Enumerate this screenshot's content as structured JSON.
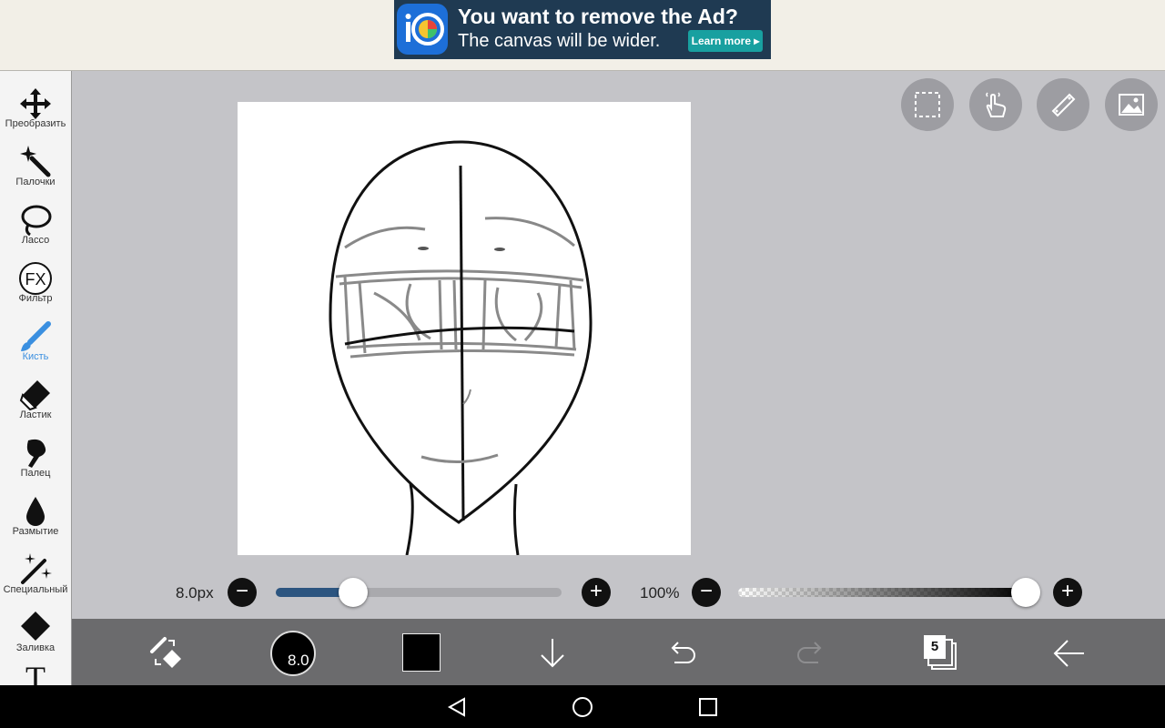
{
  "ad": {
    "title": "You want to remove the Ad?",
    "subtitle": "The canvas will be wider.",
    "cta": "Learn more ▸"
  },
  "tools": [
    {
      "label": "Преобразить",
      "icon": "move-icon"
    },
    {
      "label": "Палочки",
      "icon": "magic-wand-icon"
    },
    {
      "label": "Лассо",
      "icon": "lasso-icon"
    },
    {
      "label": "Фильтр",
      "icon": "fx-icon"
    },
    {
      "label": "Кисть",
      "icon": "brush-icon",
      "active": true
    },
    {
      "label": "Ластик",
      "icon": "eraser-icon"
    },
    {
      "label": "Палец",
      "icon": "finger-icon"
    },
    {
      "label": "Размытие",
      "icon": "blur-drop-icon"
    },
    {
      "label": "Специальный",
      "icon": "special-wand-icon"
    },
    {
      "label": "Заливка",
      "icon": "fill-bucket-icon"
    },
    {
      "label": "",
      "icon": "text-icon"
    }
  ],
  "fx_text": "FX",
  "text_tool_glyph": "T",
  "brush": {
    "size_label": "8.0px",
    "size_fraction": 0.27,
    "opacity_label": "100%",
    "opacity_fraction": 1.0,
    "indicator_value": "8.0"
  },
  "layers_count": "5",
  "colors": {
    "accent": "#3a8fe0",
    "primary_color": "#000000",
    "slider_fill": "#2c5580"
  }
}
